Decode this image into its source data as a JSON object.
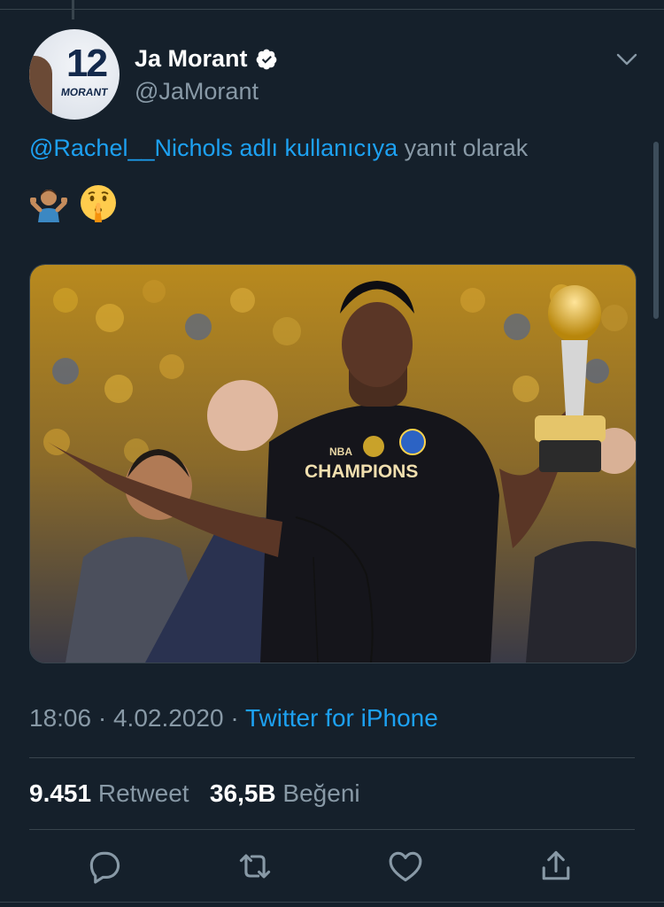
{
  "tweet": {
    "display_name": "Ja Morant",
    "handle": "@JaMorant",
    "avatar": {
      "jersey_number": "12",
      "jersey_name": "MORANT"
    },
    "reply_mention": "@Rachel__Nichols adlı kullanıcıya",
    "reply_suffix": "yanıt olarak",
    "emojis": [
      "person-shrugging-emoji",
      "shushing-face-emoji"
    ],
    "media": {
      "shirt_line1": "NBA",
      "shirt_line2": "CHAMPIONS"
    },
    "time": "18:06",
    "date": "4.02.2020",
    "separator": "·",
    "source": "Twitter for iPhone",
    "retweet_count": "9.451",
    "retweet_label": "Retweet",
    "like_count": "36,5B",
    "like_label": "Beğeni"
  },
  "actions": [
    "reply-icon",
    "retweet-icon",
    "like-icon",
    "share-icon"
  ],
  "colors": {
    "background": "#15202b",
    "accent": "#1da1f2",
    "secondary_text": "#8899a6",
    "border": "#38444d"
  }
}
